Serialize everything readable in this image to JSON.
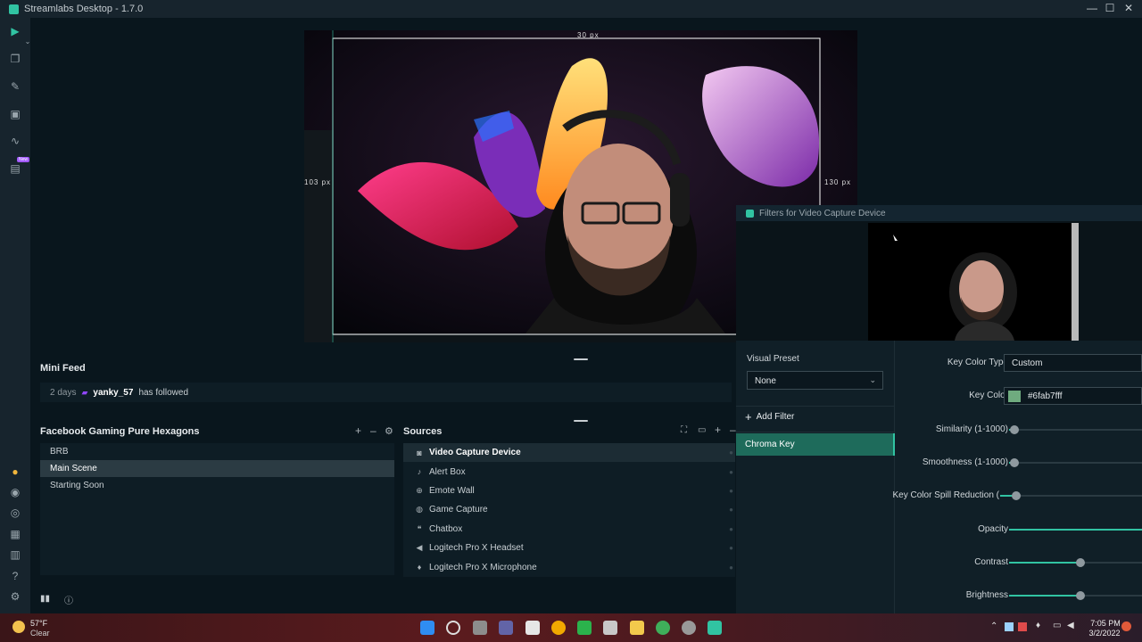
{
  "app": {
    "title": "Streamlabs Desktop - 1.7.0"
  },
  "titlebar": {
    "minimize": "—",
    "maximize": "☐",
    "close": "✕"
  },
  "sidebar": {
    "new_badge": "New"
  },
  "editor": {
    "overlay_top": "30 px",
    "overlay_left": "103 px",
    "overlay_right": "130 px"
  },
  "minifeed": {
    "title": "Mini Feed",
    "item": {
      "time": "2 days",
      "user": "yanky_57",
      "action": "has followed"
    }
  },
  "scenes": {
    "collection": "Facebook Gaming Pure Hexagons",
    "items": [
      {
        "label": "BRB"
      },
      {
        "label": "Main Scene"
      },
      {
        "label": "Starting Soon"
      }
    ]
  },
  "sources": {
    "title": "Sources",
    "items": [
      {
        "label": "Video Capture Device",
        "icon": "camera-icon"
      },
      {
        "label": "Alert Box",
        "icon": "bell-icon"
      },
      {
        "label": "Emote Wall",
        "icon": "globe-icon"
      },
      {
        "label": "Game Capture",
        "icon": "gamepad-icon"
      },
      {
        "label": "Chatbox",
        "icon": "chat-icon"
      },
      {
        "label": "Logitech Pro X Headset",
        "icon": "speaker-icon"
      },
      {
        "label": "Logitech Pro X Microphone",
        "icon": "microphone-icon"
      }
    ]
  },
  "filters": {
    "title": "Filters for Video Capture Device",
    "visual_preset_label": "Visual Preset",
    "visual_preset_value": "None",
    "add_filter": "Add Filter",
    "filter_items": [
      "Chroma Key"
    ],
    "props": {
      "key_color_type_label": "Key Color Type",
      "key_color_type_value": "Custom",
      "key_color_label": "Key Color",
      "key_color_value": "#6fab7fff",
      "key_color_swatch": "#6fab7f",
      "similarity_label": "Similarity (1-1000)",
      "similarity_fraction": 0.04,
      "smoothness_label": "Smoothness (1-1000)",
      "smoothness_fraction": 0.04,
      "spill_label": "Key Color Spill Reduction (",
      "spill_fraction": 0.11,
      "opacity_label": "Opacity",
      "opacity_fraction": 1.0,
      "contrast_label": "Contrast",
      "contrast_fraction": 0.53,
      "brightness_label": "Brightness",
      "brightness_fraction": 0.53
    }
  },
  "taskbar": {
    "weather_temp": "57°F",
    "weather_desc": "Clear",
    "time": "7:05 PM",
    "date": "3/2/2022"
  },
  "colors": {
    "accent": "#31c3a2"
  }
}
